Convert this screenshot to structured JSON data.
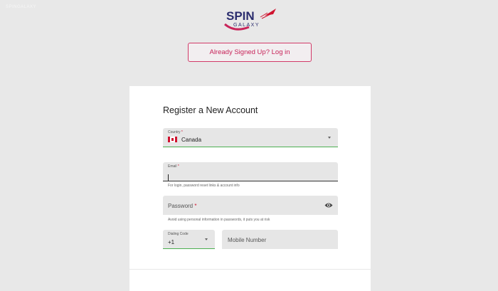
{
  "corner_text": "SPINGALAXY",
  "logo": {
    "line1": "SPIN",
    "line2": "GALAXY",
    "colors": {
      "red": "#d0132f",
      "dark": "#2b2d6e",
      "magenta": "#c8245a"
    }
  },
  "login_button": "Already Signed Up? Log in",
  "form": {
    "title": "Register a New Account",
    "country": {
      "label": "Country",
      "required_mark": "*",
      "value": "Canada",
      "flag_icon": "canada-flag-icon"
    },
    "email": {
      "label": "Email",
      "required_mark": "*",
      "value": "",
      "hint": "For login, password reset links & account info"
    },
    "password": {
      "label": "Password",
      "required_mark": "*",
      "hint": "Avoid using personal information in passwords, it puts you at risk",
      "toggle_icon": "eye-icon"
    },
    "dialing_code": {
      "label": "Dialing Code",
      "value": "+1"
    },
    "mobile": {
      "placeholder": "Mobile Number"
    }
  },
  "colors": {
    "accent": "#c8245a",
    "success_underline": "#4caf50",
    "field_bg": "#e6e6e6",
    "page_bg": "#e8e8e8"
  }
}
